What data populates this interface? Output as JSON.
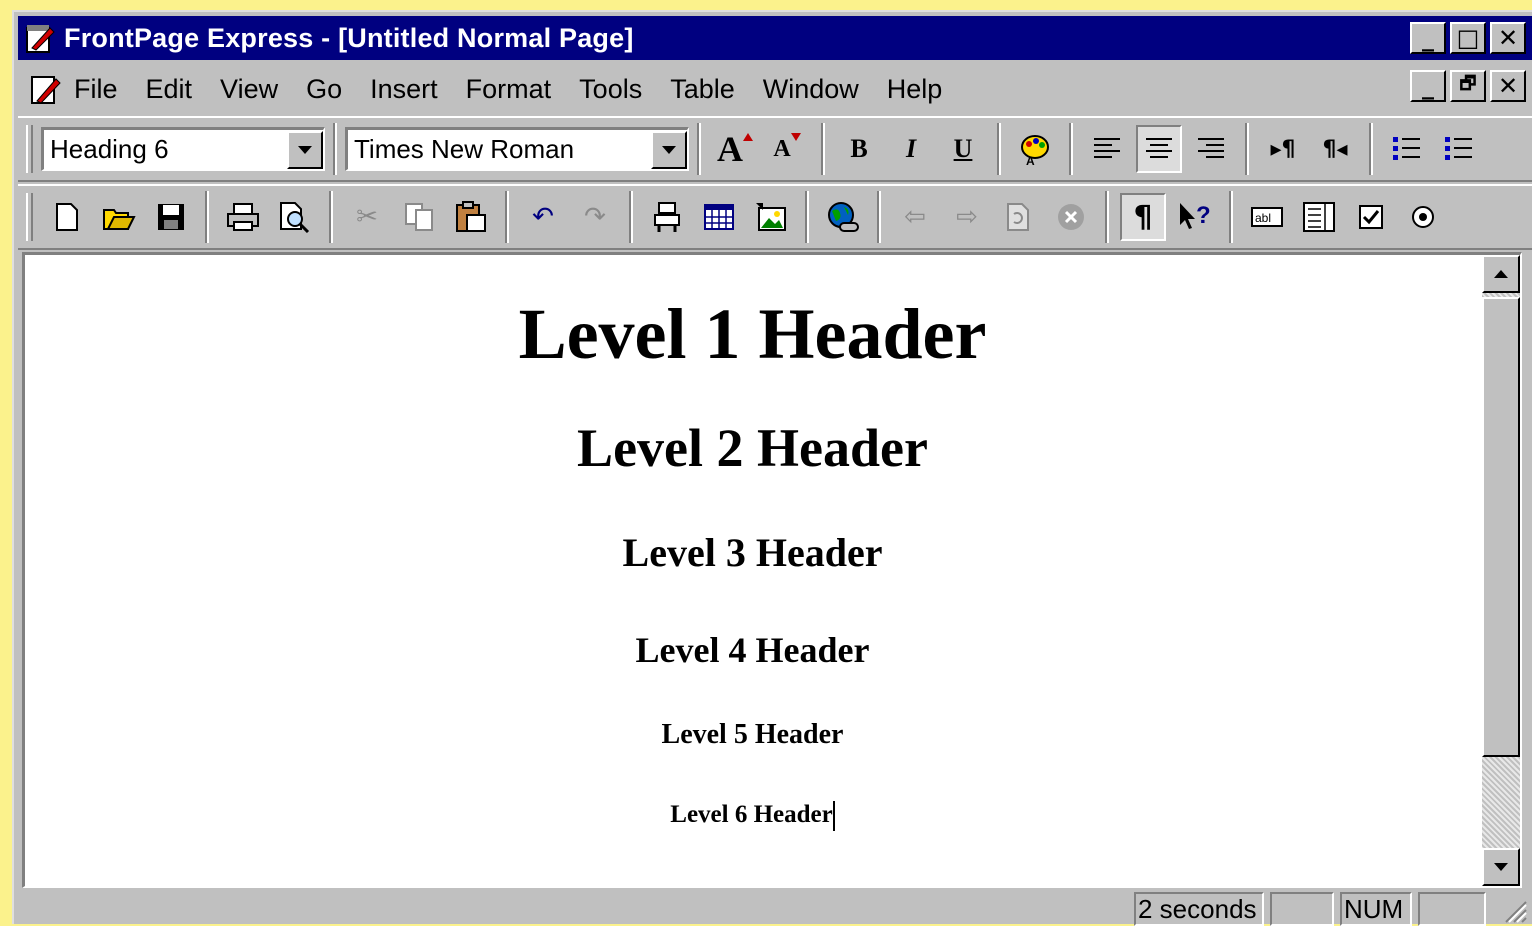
{
  "window": {
    "title": "FrontPage Express - [Untitled Normal Page]",
    "controls": {
      "minimize": "_",
      "maximize": "□",
      "close": "✕",
      "restore": "🗗"
    }
  },
  "menu": [
    "File",
    "Edit",
    "View",
    "Go",
    "Insert",
    "Format",
    "Tools",
    "Table",
    "Window",
    "Help"
  ],
  "format_toolbar": {
    "style_value": "Heading 6",
    "font_value": "Times New Roman",
    "bold": "B",
    "italic": "I",
    "underline": "U",
    "increase_font": "A",
    "decrease_font": "A"
  },
  "document": {
    "headings": [
      {
        "level": 1,
        "text": "Level 1 Header"
      },
      {
        "level": 2,
        "text": "Level 2 Header"
      },
      {
        "level": 3,
        "text": "Level 3 Header"
      },
      {
        "level": 4,
        "text": "Level 4 Header"
      },
      {
        "level": 5,
        "text": "Level 5 Header"
      },
      {
        "level": 6,
        "text": "Level 6 Header"
      }
    ]
  },
  "status": {
    "load_time": "2 seconds",
    "caps": "",
    "num": "NUM",
    "scrl": ""
  },
  "colors": {
    "desktop": "#fbf28c",
    "titlebar": "#000080",
    "chrome": "#c0c0c0"
  }
}
